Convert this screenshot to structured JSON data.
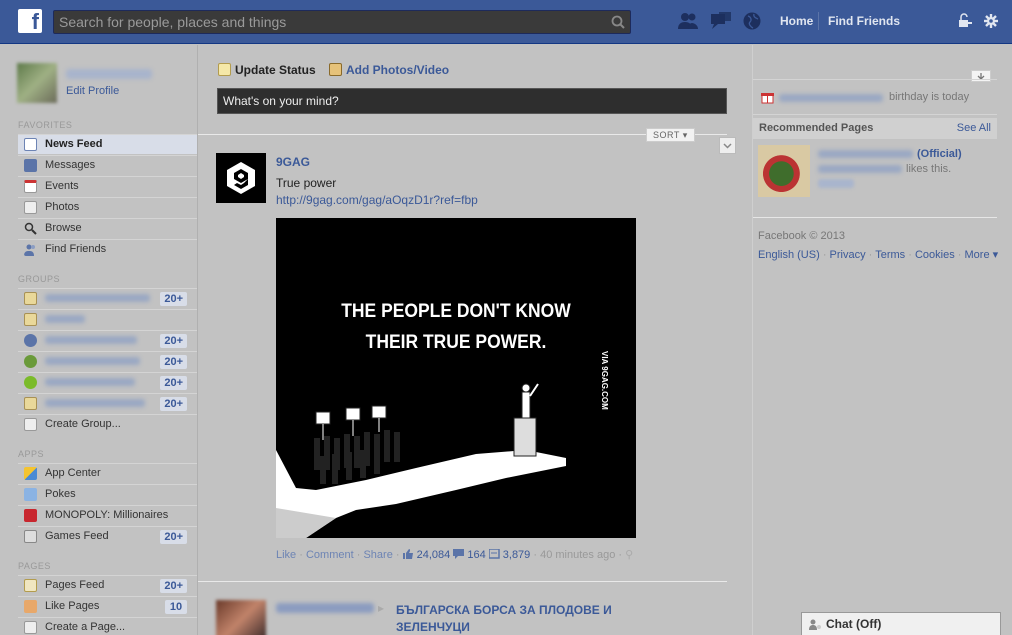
{
  "topbar": {
    "search_placeholder": "Search for people, places and things",
    "nav_home": "Home",
    "nav_find_friends": "Find Friends",
    "brand_color": "#3b5998"
  },
  "left": {
    "edit_profile": "Edit Profile",
    "favorites_header": "FAVORITES",
    "favorites": [
      {
        "label": "News Feed",
        "icon": "news-feed-icon"
      },
      {
        "label": "Messages",
        "icon": "messages-icon"
      },
      {
        "label": "Events",
        "icon": "events-icon"
      },
      {
        "label": "Photos",
        "icon": "photos-icon"
      },
      {
        "label": "Browse",
        "icon": "browse-icon"
      },
      {
        "label": "Find Friends",
        "icon": "find-friends-icon"
      }
    ],
    "groups_header": "GROUPS",
    "group_counts": [
      "20+",
      "20+",
      "20+",
      "20+",
      "20+"
    ],
    "create_group": "Create Group...",
    "apps_header": "APPS",
    "apps": [
      {
        "label": "App Center",
        "icon": "app-center-icon"
      },
      {
        "label": "Pokes",
        "icon": "pokes-icon"
      },
      {
        "label": "MONOPOLY: Millionaires",
        "icon": "monopoly-icon"
      },
      {
        "label": "Games Feed",
        "icon": "games-feed-icon",
        "count": "20+"
      }
    ],
    "pages_header": "PAGES",
    "pages": [
      {
        "label": "Pages Feed",
        "icon": "pages-feed-icon",
        "count": "20+"
      },
      {
        "label": "Like Pages",
        "icon": "like-pages-icon",
        "count": "10"
      },
      {
        "label": "Create a Page...",
        "icon": "create-page-icon"
      }
    ]
  },
  "composer": {
    "tab_status": "Update Status",
    "tab_photo": "Add Photos/Video",
    "placeholder": "What's on your mind?"
  },
  "feed": {
    "sort_label": "SORT",
    "post": {
      "author": "9GAG",
      "text": "True power",
      "link": "http://9gag.com/gag/aOqzD1r?ref=fbp",
      "image_caption_line1": "THE PEOPLE DON'T KNOW",
      "image_caption_line2": "THEIR TRUE POWER.",
      "image_watermark": "VIA 9GAG.COM",
      "action_like": "Like",
      "action_comment": "Comment",
      "action_share": "Share",
      "likes": "24,084",
      "comments": "164",
      "shares": "3,879",
      "time": "40 minutes ago"
    },
    "post2": {
      "target_line1": "БЪЛГАРСКА БОРСА ЗА ПЛОДОВЕ И",
      "target_line2": "ЗЕЛЕНЧУЦИ"
    }
  },
  "right": {
    "birthday_text": "birthday is today",
    "recommended_title": "Recommended Pages",
    "see_all": "See All",
    "rec_name_suffix": "(Official)",
    "rec_likes": "likes this.",
    "copyright": "Facebook © 2013",
    "footer_links": [
      "English (US)",
      "Privacy",
      "Terms",
      "Cookies",
      "More ▾"
    ]
  },
  "chat": {
    "label": "Chat (Off)"
  }
}
